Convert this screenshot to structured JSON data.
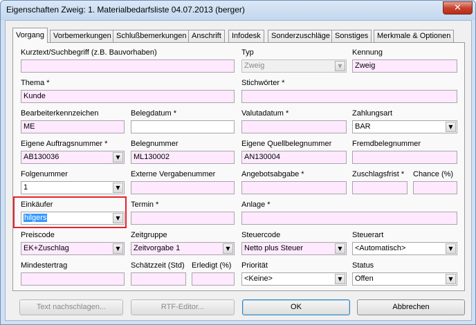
{
  "window": {
    "title": "Eigenschaften Zweig: 1. Materialbedarfsliste 04.07.2013 (berger)",
    "close_glyph": "✕"
  },
  "tabs": [
    {
      "label": "Vorgang",
      "active": true
    },
    {
      "label": "Vorbemerkungen"
    },
    {
      "label": "Schlußbemerkungen"
    },
    {
      "label": "Anschrift"
    },
    {
      "label": "Infodesk"
    },
    {
      "label": "Sonderzuschläge"
    },
    {
      "label": "Sonstiges"
    },
    {
      "label": "Merkmale & Optionen"
    }
  ],
  "form": {
    "kurztext": {
      "label": "Kurztext/Suchbegriff (z.B. Bauvorhaben)",
      "value": ""
    },
    "typ": {
      "label": "Typ",
      "value": "Zweig"
    },
    "kennung": {
      "label": "Kennung",
      "value": "Zweig"
    },
    "thema": {
      "label": "Thema *",
      "value": "Kunde"
    },
    "stichwoerter": {
      "label": "Stichwörter *",
      "value": ""
    },
    "bearbeiterkennzeichen": {
      "label": "Bearbeiterkennzeichen",
      "value": "ME"
    },
    "belegdatum": {
      "label": "Belegdatum *",
      "value": ""
    },
    "valutadatum": {
      "label": "Valutadatum *",
      "value": ""
    },
    "zahlungsart": {
      "label": "Zahlungsart",
      "value": "BAR"
    },
    "eigene_auftragsnummer": {
      "label": "Eigene Auftragsnummer *",
      "value": "AB130036"
    },
    "belegnummer": {
      "label": "Belegnummer",
      "value": "ML130002"
    },
    "eigene_quellbelegnummer": {
      "label": "Eigene Quellbelegnummer",
      "value": "AN130004"
    },
    "fremdbelegnummer": {
      "label": "Fremdbelegnummer",
      "value": ""
    },
    "folgenummer": {
      "label": "Folgenummer",
      "value": "1"
    },
    "externe_vergabenummer": {
      "label": "Externe Vergabenummer",
      "value": ""
    },
    "angebotsabgabe": {
      "label": "Angebotsabgabe *",
      "value": ""
    },
    "zuschlagsfrist": {
      "label": "Zuschlagsfrist *",
      "value": ""
    },
    "chance": {
      "label": "Chance (%)",
      "value": ""
    },
    "einkaeufer": {
      "label": "Einkäufer",
      "value": "hilgers"
    },
    "termin": {
      "label": "Termin *",
      "value": ""
    },
    "anlage": {
      "label": "Anlage *",
      "value": ""
    },
    "preiscode": {
      "label": "Preiscode",
      "value": "EK+Zuschlag"
    },
    "zeitgruppe": {
      "label": "Zeitgruppe",
      "value": "Zeitvorgabe 1"
    },
    "steuercode": {
      "label": "Steuercode",
      "value": "Netto plus Steuer"
    },
    "steuerart": {
      "label": "Steuerart",
      "value": "<Automatisch>"
    },
    "mindestertrag": {
      "label": "Mindestertrag",
      "value": ""
    },
    "schaetzzeit": {
      "label": "Schätzzeit (Std)",
      "value": ""
    },
    "erledigt": {
      "label": "Erledigt (%)",
      "value": ""
    },
    "prioritaet": {
      "label": "Priorität",
      "value": "<Keine>"
    },
    "status": {
      "label": "Status",
      "value": "Offen"
    }
  },
  "icons": {
    "dropdown": "▼"
  },
  "buttons": {
    "text_nachschlagen": "Text nachschlagen...",
    "rtf_editor": "RTF-Editor...",
    "ok": "OK",
    "abbrechen": "Abbrechen"
  }
}
